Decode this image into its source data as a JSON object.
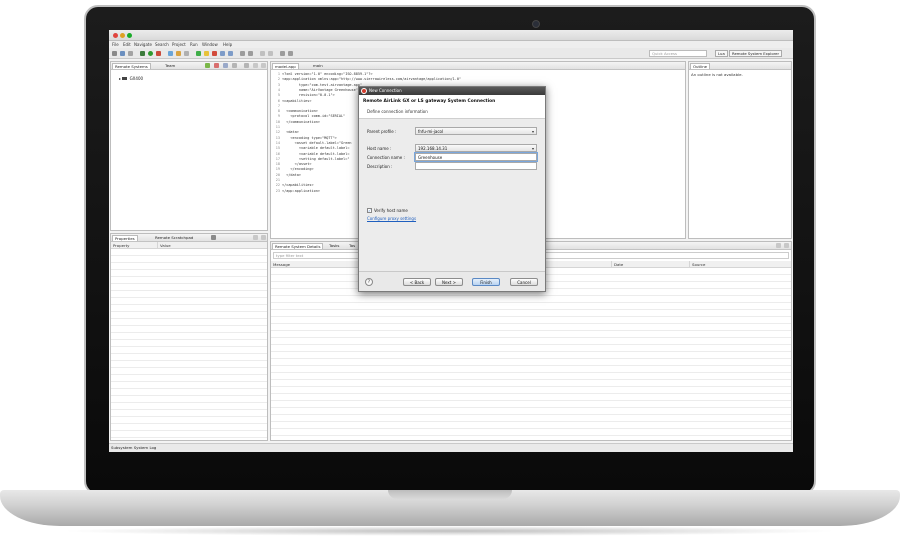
{
  "window": {
    "title": ""
  },
  "menu": [
    "File",
    "Edit",
    "Navigate",
    "Search",
    "Project",
    "Run",
    "Window",
    "Help"
  ],
  "toolbar": {
    "quick_access_placeholder": "Quick Access",
    "perspectives": [
      "Lua",
      "Remote System Explorer"
    ]
  },
  "left_panel": {
    "tabs": [
      "Remote Systems",
      "Team"
    ],
    "tree": [
      {
        "label": "GX400"
      }
    ]
  },
  "editor": {
    "tabs": [
      "model.app",
      "main"
    ],
    "lines": [
      {
        "n": "1",
        "text": "<?xml version=\"1.0\" encoding=\"ISO-8859-1\"?>"
      },
      {
        "n": "2",
        "text": "<app:application xmlns:app=\"http://www.sierrawireless.com/airvantage/application/1.0\""
      },
      {
        "n": "3",
        "text": "        type=\"com.test.airvantage.app\""
      },
      {
        "n": "4",
        "text": "        name=\"AirVantage Greenhouse\""
      },
      {
        "n": "5",
        "text": "        revision=\"0.0.1\">"
      },
      {
        "n": "6",
        "text": "<capabilities>"
      },
      {
        "n": "7",
        "text": ""
      },
      {
        "n": "8",
        "text": "  <communication>"
      },
      {
        "n": "9",
        "text": "    <protocol comm-id=\"SERIAL\" "
      },
      {
        "n": "10",
        "text": "  </communication>"
      },
      {
        "n": "11",
        "text": ""
      },
      {
        "n": "12",
        "text": "  <data>"
      },
      {
        "n": "13",
        "text": "    <encoding type=\"MQTT\">"
      },
      {
        "n": "14",
        "text": "      <asset default-label=\"Green"
      },
      {
        "n": "15",
        "text": "        <variable default-label="
      },
      {
        "n": "16",
        "text": "        <variable default-label="
      },
      {
        "n": "17",
        "text": "        <setting default-label=\""
      },
      {
        "n": "18",
        "text": "      </asset>"
      },
      {
        "n": "19",
        "text": "    </encoding>"
      },
      {
        "n": "20",
        "text": "  </data>"
      },
      {
        "n": "21",
        "text": ""
      },
      {
        "n": "22",
        "text": "</capabilities>"
      },
      {
        "n": "23",
        "text": "</app:application>"
      }
    ]
  },
  "outline": {
    "tab": "Outline",
    "message": "An outline is not available."
  },
  "bottom_left": {
    "tabs": [
      "Properties",
      "Remote Scratchpad"
    ],
    "columns": [
      "Property",
      "Value"
    ]
  },
  "bottom_right": {
    "tabs": [
      "Remote System Details",
      "Tasks",
      "Tas"
    ],
    "filter_placeholder": "type filter text",
    "columns": [
      "Message",
      "Date",
      "Source"
    ]
  },
  "status": {
    "text": "Subsystem System Log"
  },
  "dialog": {
    "window_title": "New Connection",
    "title": "Remote AirLink GX or LS gateway System Connection",
    "subtitle": "Define connection information",
    "parent_profile_label": "Parent profile :",
    "parent_profile_value": "fnfu-mi-jacol",
    "host_name_label": "Host name :",
    "host_name_value": "192.168.14.31",
    "connection_name_label": "Connection name :",
    "connection_name_value": "Greenhouse",
    "description_label": "Description :",
    "description_value": "",
    "verify_host_label": "Verify host name",
    "verify_host_checked": true,
    "proxy_link": "Configure proxy settings",
    "help": "?",
    "back": "< Back",
    "next": "Next >",
    "finish": "Finish",
    "cancel": "Cancel"
  }
}
